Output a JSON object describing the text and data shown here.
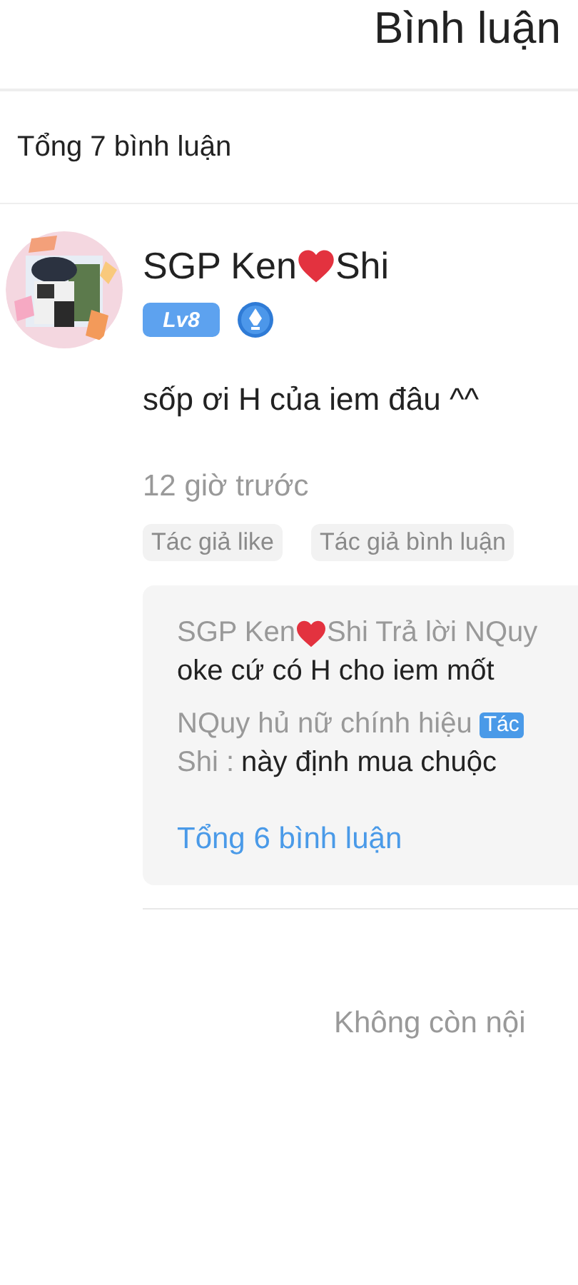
{
  "header": {
    "title": "Bình luận"
  },
  "total": "Tổng 7 bình luận",
  "comments": [
    {
      "author": [
        "SGP Ken",
        "Shi"
      ],
      "level": "Lv8",
      "text": "sốp ơi H của iem đâu ^^",
      "time": "12 giờ trước",
      "tags": [
        "Tác giả like",
        "Tác giả bình luận"
      ],
      "replies": [
        {
          "lines": [
            [
              {
                "kind": "meta",
                "text": "SGP Ken"
              },
              {
                "kind": "heart"
              },
              {
                "kind": "meta",
                "text": "Shi Trả lời NQuy"
              }
            ],
            [
              {
                "kind": "body",
                "text": "oke cứ có H cho iem mốt"
              }
            ]
          ]
        },
        {
          "lines": [
            [
              {
                "kind": "meta",
                "text": "NQuy hủ nữ chính hiệu"
              },
              {
                "kind": "badge",
                "text": "Tác"
              }
            ],
            [
              {
                "kind": "meta",
                "text": "Shi :"
              },
              {
                "kind": "body",
                "text": "này định mua chuộc"
              }
            ]
          ]
        }
      ],
      "more": "Tổng 6 bình luận"
    }
  ],
  "end_note": "Không còn nội"
}
